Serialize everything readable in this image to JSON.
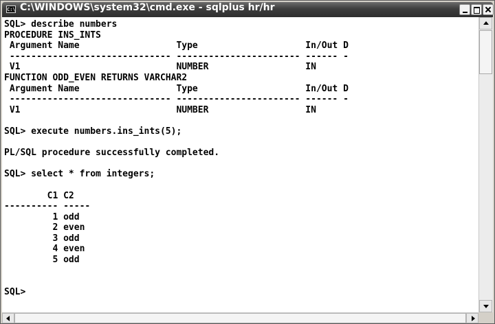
{
  "window": {
    "title": "C:\\WINDOWS\\system32\\cmd.exe - sqlplus hr/hr",
    "icon_label": "C:\\",
    "icon_name": "cmd-icon"
  },
  "title_buttons": {
    "minimize_icon": "minimize-icon",
    "maximize_icon": "maximize-icon",
    "close_icon": "close-icon"
  },
  "console": {
    "lines": [
      "SQL> describe numbers",
      "PROCEDURE INS_INTS",
      " Argument Name                  Type                    In/Out D",
      " ------------------------------ ----------------------- ------ -",
      " V1                             NUMBER                  IN",
      "FUNCTION ODD_EVEN RETURNS VARCHAR2",
      " Argument Name                  Type                    In/Out D",
      " ------------------------------ ----------------------- ------ -",
      " V1                             NUMBER                  IN",
      "",
      "SQL> execute numbers.ins_ints(5);",
      "",
      "PL/SQL procedure successfully completed.",
      "",
      "SQL> select * from integers;",
      "",
      "        C1 C2",
      "---------- -----",
      "         1 odd",
      "         2 even",
      "         3 odd",
      "         4 even",
      "         5 odd",
      "",
      "",
      "SQL>"
    ]
  },
  "colors": {
    "titlebar": "#3d3d3d",
    "console_bg": "#ffffff",
    "console_text": "#000000"
  }
}
